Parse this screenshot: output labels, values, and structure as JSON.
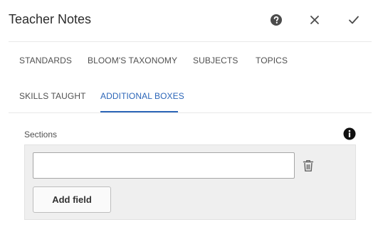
{
  "dialog": {
    "title": "Teacher Notes",
    "actions": {
      "help_icon": "help-icon",
      "close_icon": "close-icon",
      "done_icon": "check-icon"
    }
  },
  "tabs": [
    {
      "label": "STANDARDS",
      "active": false
    },
    {
      "label": "BLOOM'S TAXONOMY",
      "active": false
    },
    {
      "label": "SUBJECTS",
      "active": false
    },
    {
      "label": "TOPICS",
      "active": false
    },
    {
      "label": "SKILLS TAUGHT",
      "active": false
    },
    {
      "label": "ADDITIONAL BOXES",
      "active": true
    }
  ],
  "sections": {
    "label": "Sections",
    "info_icon": "info-icon",
    "field_value": "",
    "delete_icon": "trash-icon",
    "add_button_label": "Add field"
  },
  "colors": {
    "accent": "#2c66b8",
    "panel_bg": "#efefef"
  }
}
